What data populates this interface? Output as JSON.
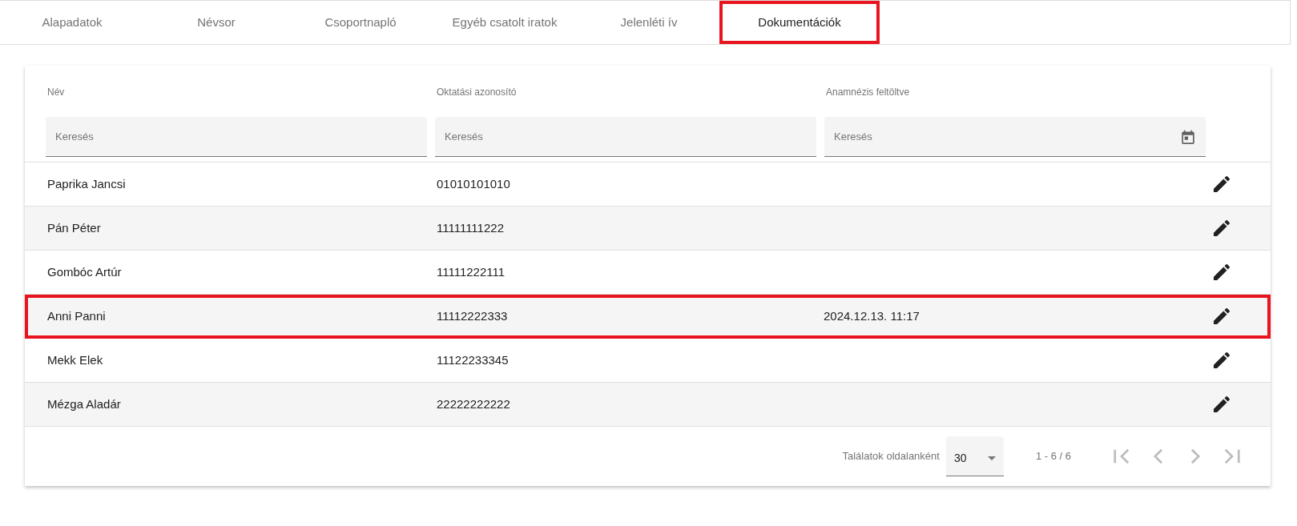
{
  "tabs": [
    {
      "label": "Alapadatok",
      "selected": false,
      "highlighted": false
    },
    {
      "label": "Névsor",
      "selected": false,
      "highlighted": false
    },
    {
      "label": "Csoportnapló",
      "selected": false,
      "highlighted": false
    },
    {
      "label": "Egyéb csatolt iratok",
      "selected": false,
      "highlighted": false
    },
    {
      "label": "Jelenléti ív",
      "selected": false,
      "highlighted": false
    },
    {
      "label": "Dokumentációk",
      "selected": true,
      "highlighted": true
    }
  ],
  "table": {
    "columns": [
      {
        "label": "Név",
        "placeholder": "Keresés",
        "kind": "text"
      },
      {
        "label": "Oktatási azonosító",
        "placeholder": "Keresés",
        "kind": "text"
      },
      {
        "label": "Anamnézis feltöltve",
        "placeholder": "Keresés",
        "kind": "date"
      }
    ],
    "rows": [
      {
        "cells": [
          "Paprika Jancsi",
          "01010101010",
          ""
        ],
        "highlighted": false
      },
      {
        "cells": [
          "Pán Péter",
          "11111111222",
          ""
        ],
        "highlighted": false
      },
      {
        "cells": [
          "Gombóc Artúr",
          "11111222111",
          ""
        ],
        "highlighted": false
      },
      {
        "cells": [
          "Anni Panni",
          "11112222333",
          "2024.12.13. 11:17"
        ],
        "highlighted": true
      },
      {
        "cells": [
          "Mekk Elek",
          "11122233345",
          ""
        ],
        "highlighted": false
      },
      {
        "cells": [
          "Mézga Aladár",
          "22222222222",
          ""
        ],
        "highlighted": false
      }
    ]
  },
  "paginator": {
    "page_size_label": "Találatok oldalanként",
    "page_size": "30",
    "range": "1 - 6 / 6",
    "buttons": [
      {
        "kind": "first",
        "disabled": true
      },
      {
        "kind": "prev",
        "disabled": true
      },
      {
        "kind": "next",
        "disabled": true
      },
      {
        "kind": "last",
        "disabled": true
      }
    ]
  }
}
